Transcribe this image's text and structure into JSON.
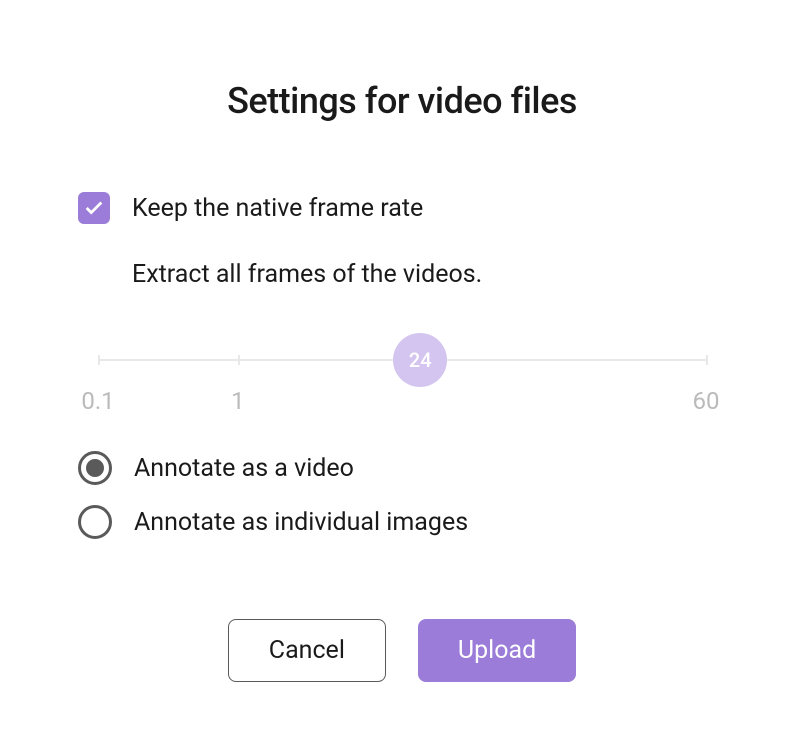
{
  "dialog": {
    "title": "Settings for video files",
    "checkbox": {
      "checked": true,
      "label": "Keep the native frame rate"
    },
    "description": "Extract all frames of the videos.",
    "slider": {
      "value": "24",
      "min_label": "0.1",
      "mid_label": "1",
      "max_label": "60",
      "thumb_position_pct": 53,
      "tick1_pct": 0,
      "tick2_pct": 23,
      "tick3_pct": 100
    },
    "radio_options": [
      {
        "label": "Annotate as a video",
        "selected": true
      },
      {
        "label": "Annotate as individual images",
        "selected": false
      }
    ],
    "buttons": {
      "cancel": "Cancel",
      "upload": "Upload"
    }
  }
}
